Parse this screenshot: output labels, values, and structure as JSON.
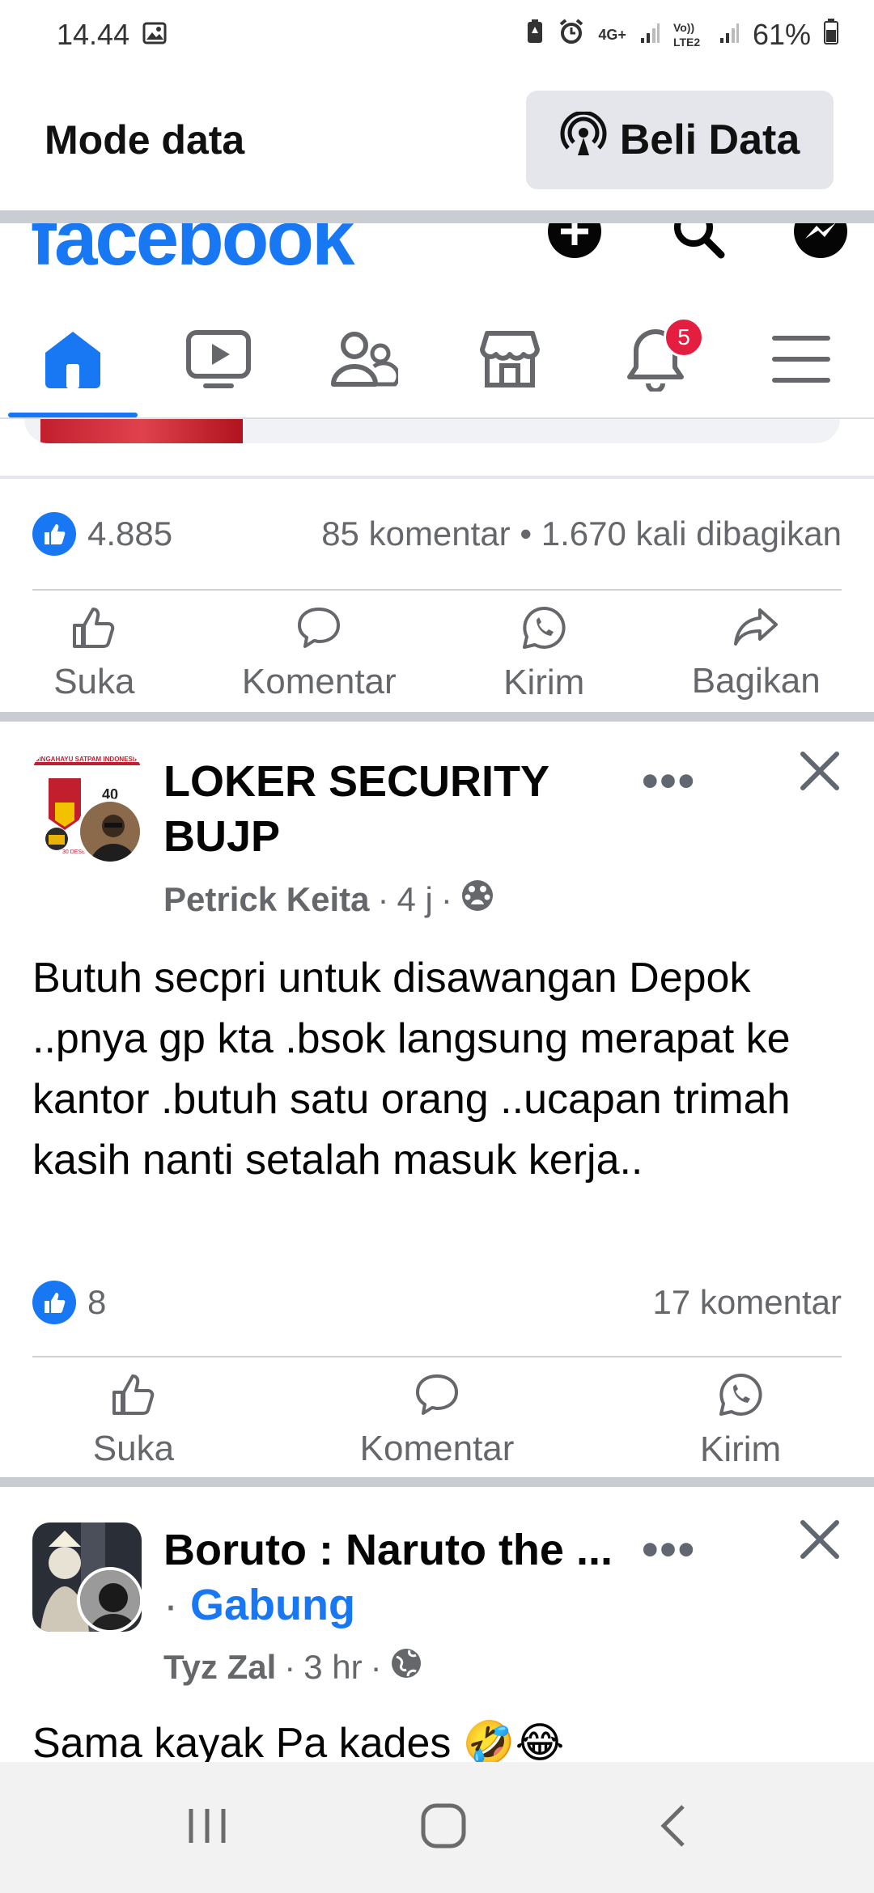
{
  "status_bar": {
    "time": "14.44",
    "network_4g": "4G+",
    "network_volte": "Vo)) LTE2",
    "battery_percent": "61%"
  },
  "data_bar": {
    "title": "Mode data",
    "buy_button": "Beli Data"
  },
  "app": {
    "logo_text": "facebook",
    "notification_count": "5"
  },
  "previous_post": {
    "reaction_count": "4.885",
    "comments": "85 komentar",
    "shares": "1.670 kali dibagikan",
    "actions": [
      "Suka",
      "Komentar",
      "Kirim",
      "Bagikan"
    ]
  },
  "post1": {
    "group_name": "LOKER SECURITY BUJP",
    "author": "Petrick Keita",
    "time": "4 j",
    "body": "Butuh secpri untuk disawangan Depok ..pnya gp kta .bsok langsung merapat ke kantor .butuh satu orang ..ucapan trimah kasih nanti setalah masuk kerja..",
    "reaction_count": "8",
    "comments": "17 komentar",
    "actions": [
      "Suka",
      "Komentar",
      "Kirim"
    ],
    "avatar_text_top": "SINGAHAYU SATPAM INDONESIA",
    "avatar_text_ke": "KE -",
    "avatar_text_num": "40",
    "avatar_text_date": "30 DESEMBER 1%"
  },
  "post2": {
    "group_name": "Boruto : Naruto the ...",
    "join_label": "Gabung",
    "author": "Tyz Zal",
    "time": "3 hr",
    "body": "Sama kayak Pa kades 🤣😂"
  },
  "colors": {
    "brand": "#1877f2",
    "badge": "#e41e3f",
    "muted": "#65676b"
  }
}
